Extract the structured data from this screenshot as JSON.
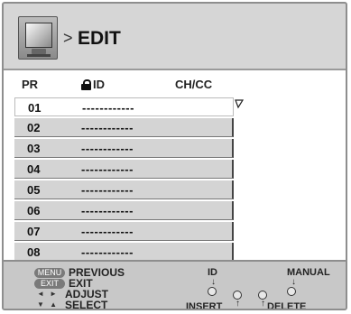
{
  "header": {
    "separator": ">",
    "title": "EDIT",
    "icon": "tv-monitor-icon"
  },
  "columns": {
    "pr": "PR",
    "id": "ID",
    "chcc": "CH/CC"
  },
  "rows": [
    {
      "pr": "01",
      "id": "------------"
    },
    {
      "pr": "02",
      "id": "------------"
    },
    {
      "pr": "03",
      "id": "------------"
    },
    {
      "pr": "04",
      "id": "------------"
    },
    {
      "pr": "05",
      "id": "------------"
    },
    {
      "pr": "06",
      "id": "------------"
    },
    {
      "pr": "07",
      "id": "------------"
    },
    {
      "pr": "08",
      "id": "------------"
    }
  ],
  "selected_row": "01",
  "legend": {
    "menu_key": "MENU",
    "menu_text": "PREVIOUS",
    "exit_key": "EXIT",
    "exit_text": "EXIT",
    "adjust_keys": "◄ ►",
    "adjust_text": "ADJUST",
    "select_keys": "▼ ▲",
    "select_text": "SELECT"
  },
  "color_keys": {
    "id": "ID",
    "manual": "MANUAL",
    "insert": "INSERT",
    "delete": "DELETE",
    "down_arrow": "↓",
    "up_arrow": "↑"
  }
}
